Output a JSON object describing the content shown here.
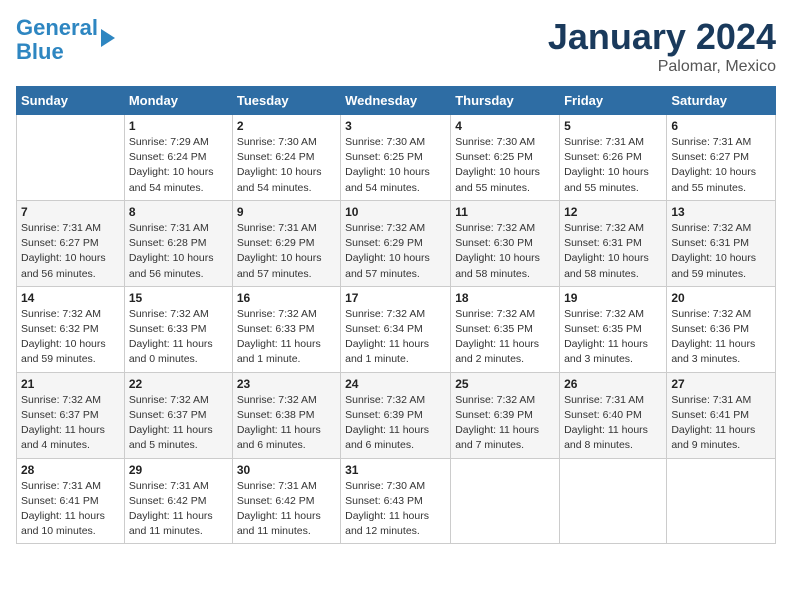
{
  "header": {
    "logo_line1": "General",
    "logo_line2": "Blue",
    "month": "January 2024",
    "location": "Palomar, Mexico"
  },
  "days_of_week": [
    "Sunday",
    "Monday",
    "Tuesday",
    "Wednesday",
    "Thursday",
    "Friday",
    "Saturday"
  ],
  "weeks": [
    [
      {
        "num": "",
        "info": ""
      },
      {
        "num": "1",
        "info": "Sunrise: 7:29 AM\nSunset: 6:24 PM\nDaylight: 10 hours\nand 54 minutes."
      },
      {
        "num": "2",
        "info": "Sunrise: 7:30 AM\nSunset: 6:24 PM\nDaylight: 10 hours\nand 54 minutes."
      },
      {
        "num": "3",
        "info": "Sunrise: 7:30 AM\nSunset: 6:25 PM\nDaylight: 10 hours\nand 54 minutes."
      },
      {
        "num": "4",
        "info": "Sunrise: 7:30 AM\nSunset: 6:25 PM\nDaylight: 10 hours\nand 55 minutes."
      },
      {
        "num": "5",
        "info": "Sunrise: 7:31 AM\nSunset: 6:26 PM\nDaylight: 10 hours\nand 55 minutes."
      },
      {
        "num": "6",
        "info": "Sunrise: 7:31 AM\nSunset: 6:27 PM\nDaylight: 10 hours\nand 55 minutes."
      }
    ],
    [
      {
        "num": "7",
        "info": "Sunrise: 7:31 AM\nSunset: 6:27 PM\nDaylight: 10 hours\nand 56 minutes."
      },
      {
        "num": "8",
        "info": "Sunrise: 7:31 AM\nSunset: 6:28 PM\nDaylight: 10 hours\nand 56 minutes."
      },
      {
        "num": "9",
        "info": "Sunrise: 7:31 AM\nSunset: 6:29 PM\nDaylight: 10 hours\nand 57 minutes."
      },
      {
        "num": "10",
        "info": "Sunrise: 7:32 AM\nSunset: 6:29 PM\nDaylight: 10 hours\nand 57 minutes."
      },
      {
        "num": "11",
        "info": "Sunrise: 7:32 AM\nSunset: 6:30 PM\nDaylight: 10 hours\nand 58 minutes."
      },
      {
        "num": "12",
        "info": "Sunrise: 7:32 AM\nSunset: 6:31 PM\nDaylight: 10 hours\nand 58 minutes."
      },
      {
        "num": "13",
        "info": "Sunrise: 7:32 AM\nSunset: 6:31 PM\nDaylight: 10 hours\nand 59 minutes."
      }
    ],
    [
      {
        "num": "14",
        "info": "Sunrise: 7:32 AM\nSunset: 6:32 PM\nDaylight: 10 hours\nand 59 minutes."
      },
      {
        "num": "15",
        "info": "Sunrise: 7:32 AM\nSunset: 6:33 PM\nDaylight: 11 hours\nand 0 minutes."
      },
      {
        "num": "16",
        "info": "Sunrise: 7:32 AM\nSunset: 6:33 PM\nDaylight: 11 hours\nand 1 minute."
      },
      {
        "num": "17",
        "info": "Sunrise: 7:32 AM\nSunset: 6:34 PM\nDaylight: 11 hours\nand 1 minute."
      },
      {
        "num": "18",
        "info": "Sunrise: 7:32 AM\nSunset: 6:35 PM\nDaylight: 11 hours\nand 2 minutes."
      },
      {
        "num": "19",
        "info": "Sunrise: 7:32 AM\nSunset: 6:35 PM\nDaylight: 11 hours\nand 3 minutes."
      },
      {
        "num": "20",
        "info": "Sunrise: 7:32 AM\nSunset: 6:36 PM\nDaylight: 11 hours\nand 3 minutes."
      }
    ],
    [
      {
        "num": "21",
        "info": "Sunrise: 7:32 AM\nSunset: 6:37 PM\nDaylight: 11 hours\nand 4 minutes."
      },
      {
        "num": "22",
        "info": "Sunrise: 7:32 AM\nSunset: 6:37 PM\nDaylight: 11 hours\nand 5 minutes."
      },
      {
        "num": "23",
        "info": "Sunrise: 7:32 AM\nSunset: 6:38 PM\nDaylight: 11 hours\nand 6 minutes."
      },
      {
        "num": "24",
        "info": "Sunrise: 7:32 AM\nSunset: 6:39 PM\nDaylight: 11 hours\nand 6 minutes."
      },
      {
        "num": "25",
        "info": "Sunrise: 7:32 AM\nSunset: 6:39 PM\nDaylight: 11 hours\nand 7 minutes."
      },
      {
        "num": "26",
        "info": "Sunrise: 7:31 AM\nSunset: 6:40 PM\nDaylight: 11 hours\nand 8 minutes."
      },
      {
        "num": "27",
        "info": "Sunrise: 7:31 AM\nSunset: 6:41 PM\nDaylight: 11 hours\nand 9 minutes."
      }
    ],
    [
      {
        "num": "28",
        "info": "Sunrise: 7:31 AM\nSunset: 6:41 PM\nDaylight: 11 hours\nand 10 minutes."
      },
      {
        "num": "29",
        "info": "Sunrise: 7:31 AM\nSunset: 6:42 PM\nDaylight: 11 hours\nand 11 minutes."
      },
      {
        "num": "30",
        "info": "Sunrise: 7:31 AM\nSunset: 6:42 PM\nDaylight: 11 hours\nand 11 minutes."
      },
      {
        "num": "31",
        "info": "Sunrise: 7:30 AM\nSunset: 6:43 PM\nDaylight: 11 hours\nand 12 minutes."
      },
      {
        "num": "",
        "info": ""
      },
      {
        "num": "",
        "info": ""
      },
      {
        "num": "",
        "info": ""
      }
    ]
  ]
}
